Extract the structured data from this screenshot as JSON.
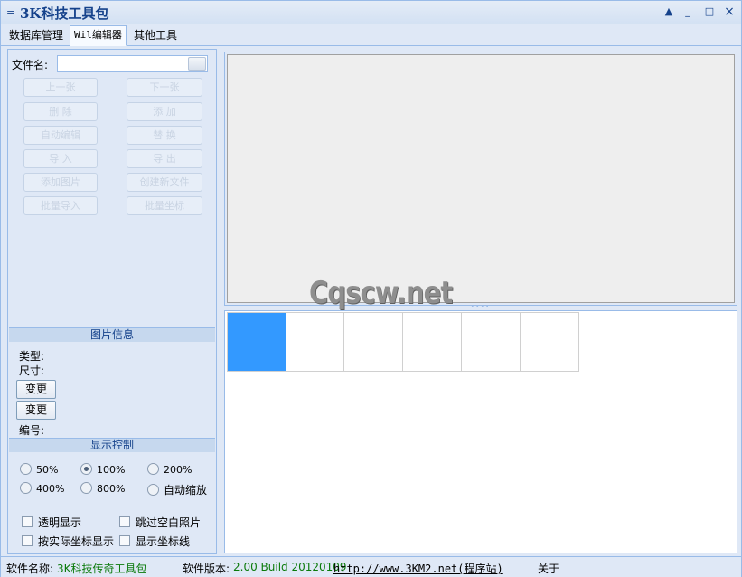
{
  "window": {
    "title": "3K科技工具包",
    "menu_glyph": "="
  },
  "window_buttons": {
    "up": "▲",
    "minimize": "_",
    "maximize": "□",
    "close": "×"
  },
  "tabs": [
    {
      "label": "数据库管理",
      "active": false
    },
    {
      "label": "Wil编辑器",
      "active": true
    },
    {
      "label": "其他工具",
      "active": false
    }
  ],
  "left": {
    "file_label": "文件名:",
    "file_value": "",
    "buttons": [
      [
        "上一张",
        "下一张"
      ],
      [
        "删  除",
        "添  加"
      ],
      [
        "自动编辑",
        "替  换"
      ],
      [
        "导  入",
        "导  出"
      ],
      [
        "添加图片",
        "创建新文件"
      ],
      [
        "批量导入",
        "批量坐标"
      ]
    ],
    "image_info": {
      "header": "图片信息",
      "type_label": "类型:",
      "size_label": "尺寸:",
      "change1": "变更",
      "change2": "变更",
      "index_label": "编号:"
    },
    "display": {
      "header": "显示控制",
      "zoom_options": [
        "50%",
        "100%",
        "200%",
        "400%",
        "800%",
        "自动缩放"
      ],
      "zoom_selected": "100%",
      "checks": [
        "透明显示",
        "跳过空白照片",
        "按实际坐标显示",
        "显示坐标线"
      ]
    }
  },
  "preview": {
    "watermark": "Cqscw.net"
  },
  "thumbnails": {
    "count": 6,
    "selected_index": 0,
    "accent": "#3399ff"
  },
  "status": {
    "name_label": "软件名称:",
    "name_value": "3K科技传奇工具包",
    "version_label": "软件版本:",
    "version_value": "2.00 Build 20120109",
    "link": "http://www.3KM2.net(程序站)",
    "about": "关于"
  }
}
